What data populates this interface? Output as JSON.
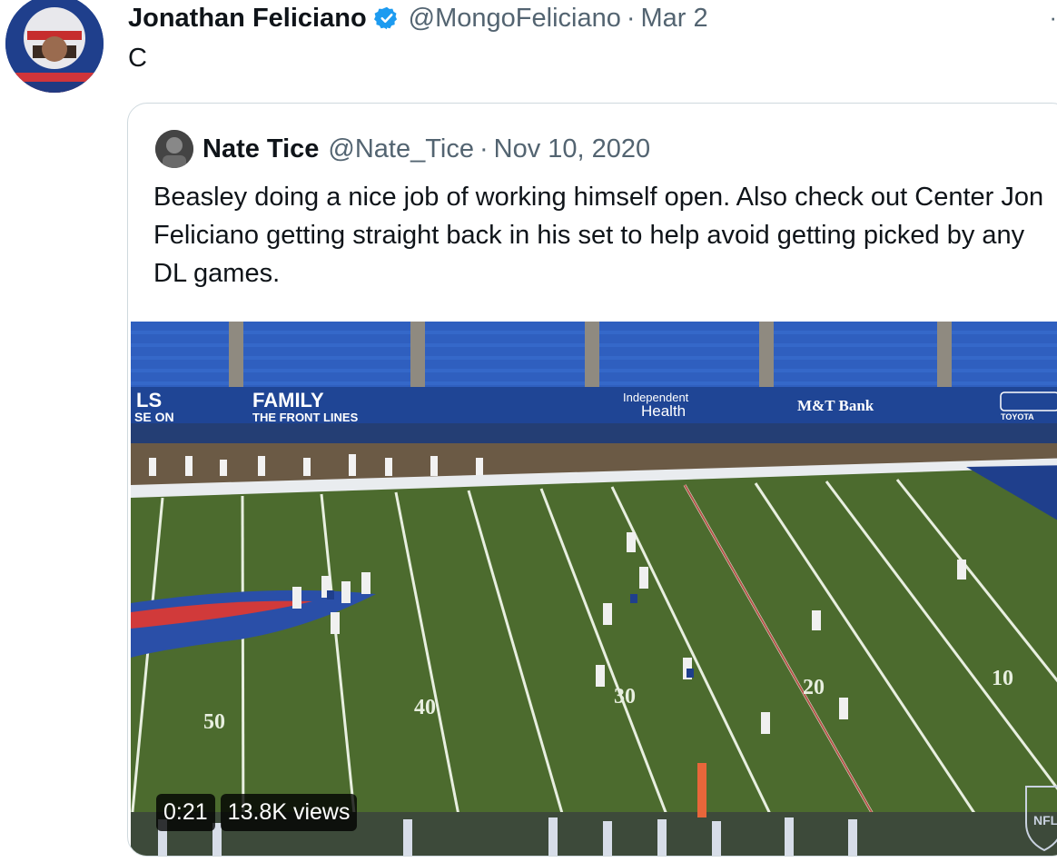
{
  "tweet": {
    "author_name": "Jonathan Feliciano",
    "handle": "@MongoFeliciano",
    "separator": "·",
    "date": "Mar 2",
    "text": "C",
    "more_icon": "more-dots-icon"
  },
  "quote": {
    "author_name": "Nate Tice",
    "handle": "@Nate_Tice",
    "separator": "·",
    "date": "Nov 10, 2020",
    "text": "Beasley doing a nice job of working himself open. Also check out Center Jon Feliciano getting straight back in his set to help avoid getting picked by any DL games."
  },
  "video": {
    "duration": "0:21",
    "views": "13.8K views",
    "banners": {
      "ls": "LS",
      "se_on": "SE ON",
      "family": "FAMILY",
      "front_lines": "THE FRONT LINES",
      "independent": "Independent",
      "health": "Health",
      "mt_bank": "M&T Bank",
      "toyota": "TOYOTA"
    },
    "yard_numbers": [
      "50",
      "40",
      "30",
      "20",
      "10"
    ],
    "nfl_logo": "NFL"
  },
  "colors": {
    "verified_blue": "#1d9bf0",
    "secondary_text": "#536471",
    "field_green": "#4c6b2e",
    "stadium_blue": "#2b57b2"
  }
}
